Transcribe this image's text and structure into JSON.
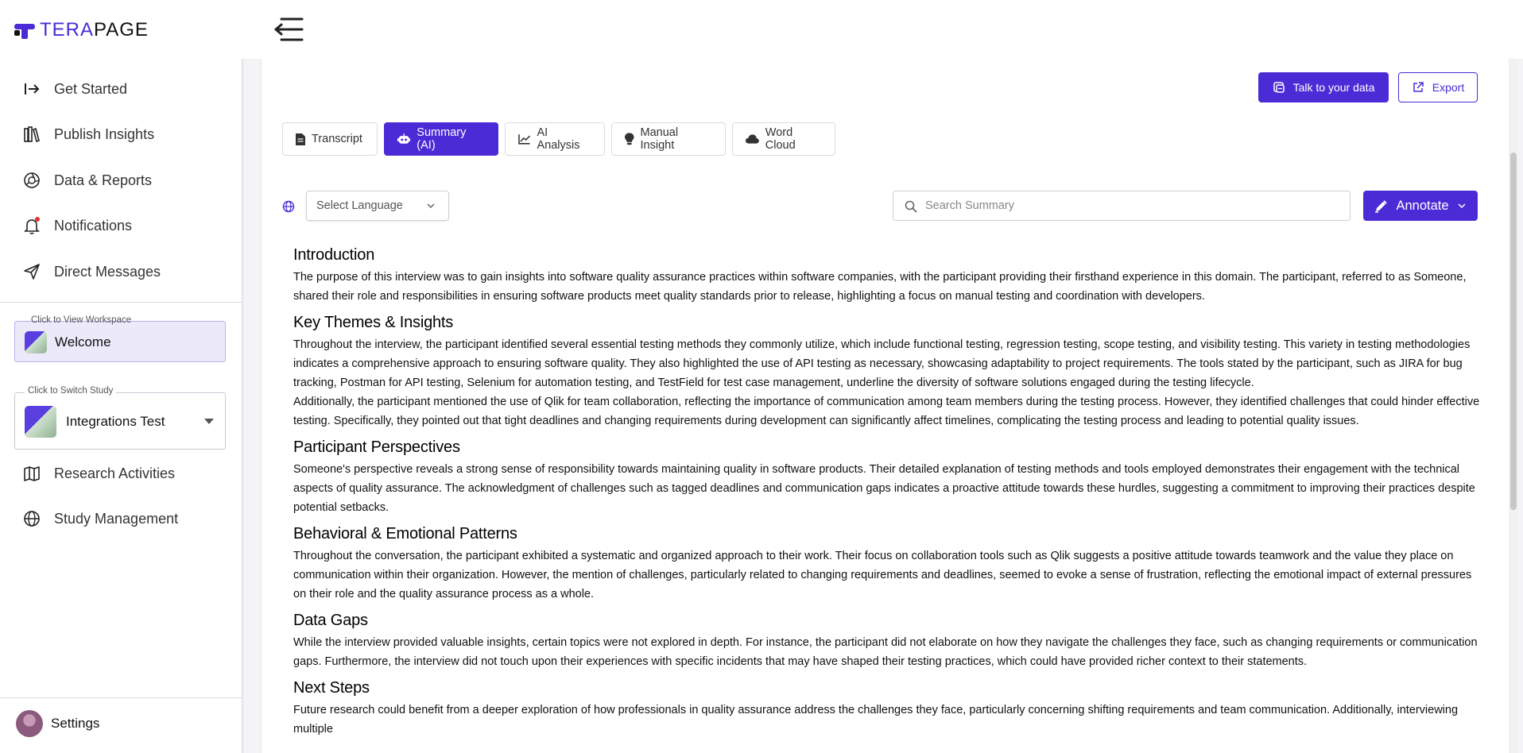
{
  "brand": {
    "name_part1": "TERA",
    "name_part2": "PAGE",
    "accent": "#4b2bd6"
  },
  "sidebar": {
    "items": [
      {
        "label": "Get Started",
        "icon": "sign-in-icon"
      },
      {
        "label": "Publish Insights",
        "icon": "books-icon"
      },
      {
        "label": "Data & Reports",
        "icon": "aperture-icon"
      },
      {
        "label": "Notifications",
        "icon": "bell-icon"
      },
      {
        "label": "Direct Messages",
        "icon": "send-icon"
      }
    ],
    "workspace": {
      "caption": "Click to View Workspace",
      "name": "Welcome"
    },
    "study": {
      "caption": "Click to Switch Study",
      "name": "Integrations Test"
    },
    "items2": [
      {
        "label": "Research Activities",
        "icon": "map-icon"
      },
      {
        "label": "Study Management",
        "icon": "globe-icon"
      }
    ],
    "settings_label": "Settings"
  },
  "toolbar": {
    "talk_label": "Talk to your data",
    "export_label": "Export"
  },
  "tabs": [
    {
      "label": "Transcript",
      "icon": "document-icon",
      "active": false
    },
    {
      "label": "Summary (AI)",
      "icon": "robot-icon",
      "active": true
    },
    {
      "label": "AI Analysis",
      "icon": "chart-line-icon",
      "active": false
    },
    {
      "label": "Manual Insight",
      "icon": "lightbulb-icon",
      "active": false
    },
    {
      "label": "Word Cloud",
      "icon": "cloud-icon",
      "active": false
    }
  ],
  "filters": {
    "language_placeholder": "Select Language",
    "search_placeholder": "Search Summary",
    "annotate_label": "Annotate"
  },
  "summary": [
    {
      "heading": "Introduction",
      "paragraphs": [
        "The purpose of this interview was to gain insights into software quality assurance practices within software companies, with the participant providing their firsthand experience in this domain. The participant, referred to as Someone, shared their role and responsibilities in ensuring software products meet quality standards prior to release, highlighting a focus on manual testing and coordination with developers."
      ]
    },
    {
      "heading": "Key Themes & Insights",
      "paragraphs": [
        "Throughout the interview, the participant identified several essential testing methods they commonly utilize, which include functional testing, regression testing, scope testing, and visibility testing. This variety in testing methodologies indicates a comprehensive approach to ensuring software quality. They also highlighted the use of API testing as necessary, showcasing adaptability to project requirements. The tools stated by the participant, such as JIRA for bug tracking, Postman for API testing, Selenium for automation testing, and TestField for test case management, underline the diversity of software solutions engaged during the testing lifecycle.",
        "Additionally, the participant mentioned the use of Qlik for team collaboration, reflecting the importance of communication among team members during the testing process. However, they identified challenges that could hinder effective testing. Specifically, they pointed out that tight deadlines and changing requirements during development can significantly affect timelines, complicating the testing process and leading to potential quality issues."
      ]
    },
    {
      "heading": "Participant Perspectives",
      "paragraphs": [
        "Someone's perspective reveals a strong sense of responsibility towards maintaining quality in software products. Their detailed explanation of testing methods and tools employed demonstrates their engagement with the technical aspects of quality assurance. The acknowledgment of challenges such as tagged deadlines and communication gaps indicates a proactive attitude towards these hurdles, suggesting a commitment to improving their practices despite potential setbacks."
      ]
    },
    {
      "heading": "Behavioral & Emotional Patterns",
      "paragraphs": [
        "Throughout the conversation, the participant exhibited a systematic and organized approach to their work. Their focus on collaboration tools such as Qlik suggests a positive attitude towards teamwork and the value they place on communication within their organization. However, the mention of challenges, particularly related to changing requirements and deadlines, seemed to evoke a sense of frustration, reflecting the emotional impact of external pressures on their role and the quality assurance process as a whole."
      ]
    },
    {
      "heading": "Data Gaps",
      "paragraphs": [
        "While the interview provided valuable insights, certain topics were not explored in depth. For instance, the participant did not elaborate on how they navigate the challenges they face, such as changing requirements or communication gaps. Furthermore, the interview did not touch upon their experiences with specific incidents that may have shaped their testing practices, which could have provided richer context to their statements."
      ]
    },
    {
      "heading": "Next Steps",
      "paragraphs": [
        "Future research could benefit from a deeper exploration of how professionals in quality assurance address the challenges they face, particularly concerning shifting requirements and team communication. Additionally, interviewing multiple"
      ]
    }
  ]
}
